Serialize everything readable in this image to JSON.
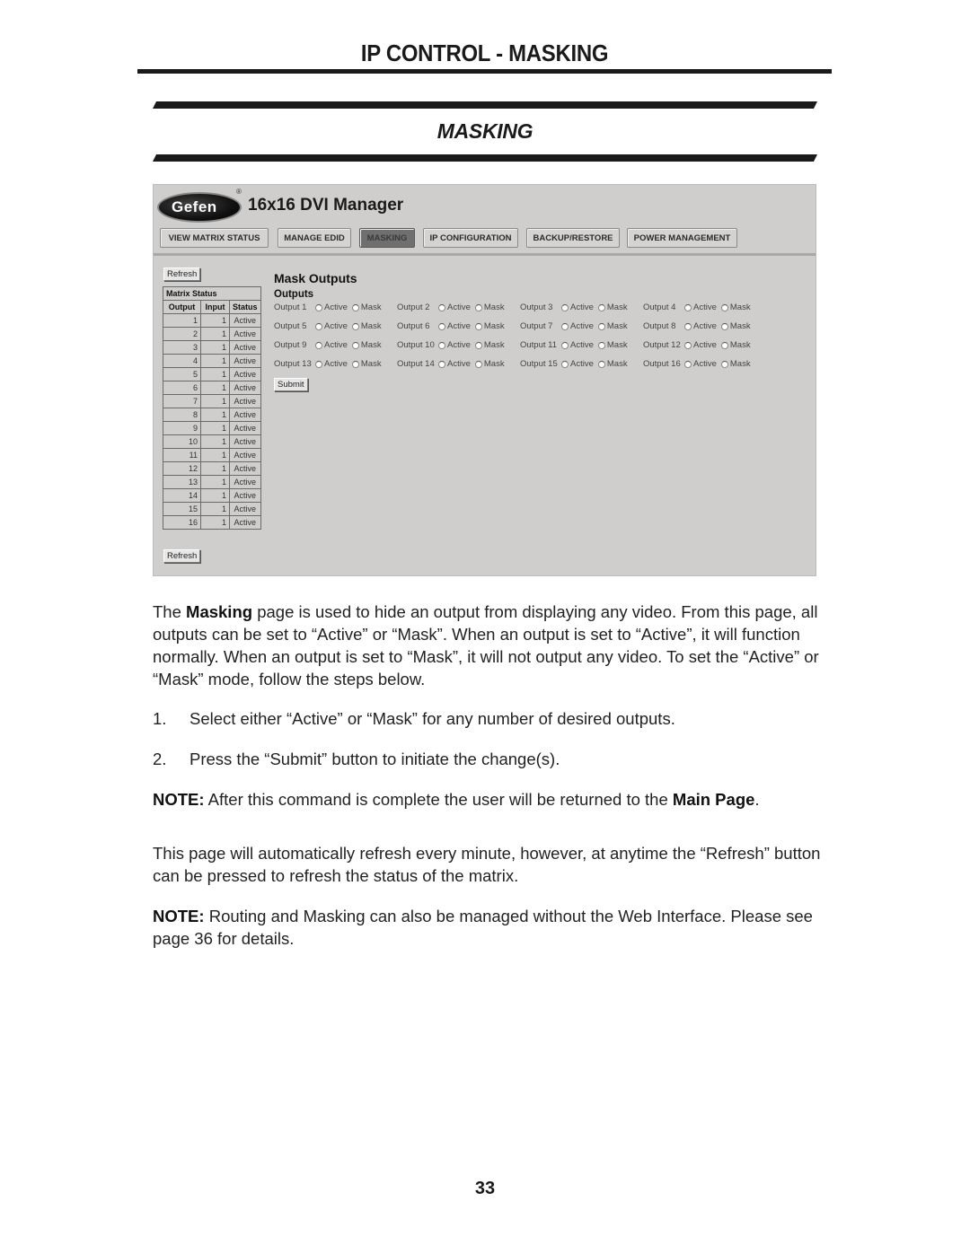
{
  "page": {
    "title": "IP CONTROL - MASKING",
    "section_title": "MASKING",
    "page_number": "33"
  },
  "ui": {
    "logo_text": "Gefen",
    "logo_reg": "®",
    "app_title": "16x16 DVI Manager",
    "nav": [
      {
        "label": "VIEW MATRIX STATUS",
        "active": false
      },
      {
        "label": "MANAGE EDID",
        "active": false
      },
      {
        "label": "MASKING",
        "active": true
      },
      {
        "label": "IP CONFIGURATION",
        "active": false
      },
      {
        "label": "BACKUP/RESTORE",
        "active": false
      },
      {
        "label": "POWER MANAGEMENT",
        "active": false
      }
    ],
    "refresh_label": "Refresh",
    "matrix": {
      "caption": "Matrix Status",
      "headers": [
        "Output",
        "Input",
        "Status"
      ],
      "rows": [
        [
          "1",
          "1",
          "Active"
        ],
        [
          "2",
          "1",
          "Active"
        ],
        [
          "3",
          "1",
          "Active"
        ],
        [
          "4",
          "1",
          "Active"
        ],
        [
          "5",
          "1",
          "Active"
        ],
        [
          "6",
          "1",
          "Active"
        ],
        [
          "7",
          "1",
          "Active"
        ],
        [
          "8",
          "1",
          "Active"
        ],
        [
          "9",
          "1",
          "Active"
        ],
        [
          "10",
          "1",
          "Active"
        ],
        [
          "11",
          "1",
          "Active"
        ],
        [
          "12",
          "1",
          "Active"
        ],
        [
          "13",
          "1",
          "Active"
        ],
        [
          "14",
          "1",
          "Active"
        ],
        [
          "15",
          "1",
          "Active"
        ],
        [
          "16",
          "1",
          "Active"
        ]
      ]
    },
    "mask": {
      "title": "Mask Outputs",
      "outputs_label": "Outputs",
      "active_label": "Active",
      "mask_label": "Mask",
      "outputs": [
        "Output 1",
        "Output 2",
        "Output 3",
        "Output 4",
        "Output 5",
        "Output 6",
        "Output 7",
        "Output 8",
        "Output 9",
        "Output 10",
        "Output 11",
        "Output 12",
        "Output 13",
        "Output 14",
        "Output 15",
        "Output 16"
      ],
      "submit_label": "Submit"
    }
  },
  "text": {
    "intro_1": "The ",
    "intro_bold": "Masking",
    "intro_2": " page is used to hide an output from displaying any video. From this page, all outputs can be set to “Active” or “Mask”. When an output is set to “Active”, it will function normally. When an output is set to “Mask”, it will not output any video. To set the “Active” or “Mask” mode, follow the steps below.",
    "steps": [
      {
        "num": "1.",
        "text": "Select either “Active” or “Mask” for any number of desired outputs."
      },
      {
        "num": "2.",
        "text": "Press the “Submit” button to initiate the change(s)."
      }
    ],
    "note1_label": "NOTE:",
    "note1_text": " After this command is complete the user will be returned to the ",
    "note1_bold": "Main Page",
    "note1_end": ".",
    "refresh_para": "This page will automatically refresh every minute, however, at anytime the “Refresh” button can be pressed to refresh the status of the matrix.",
    "note2_label": "NOTE:",
    "note2_text": " Routing and Masking can also be managed without the Web Interface. Please see page 36 for details."
  }
}
